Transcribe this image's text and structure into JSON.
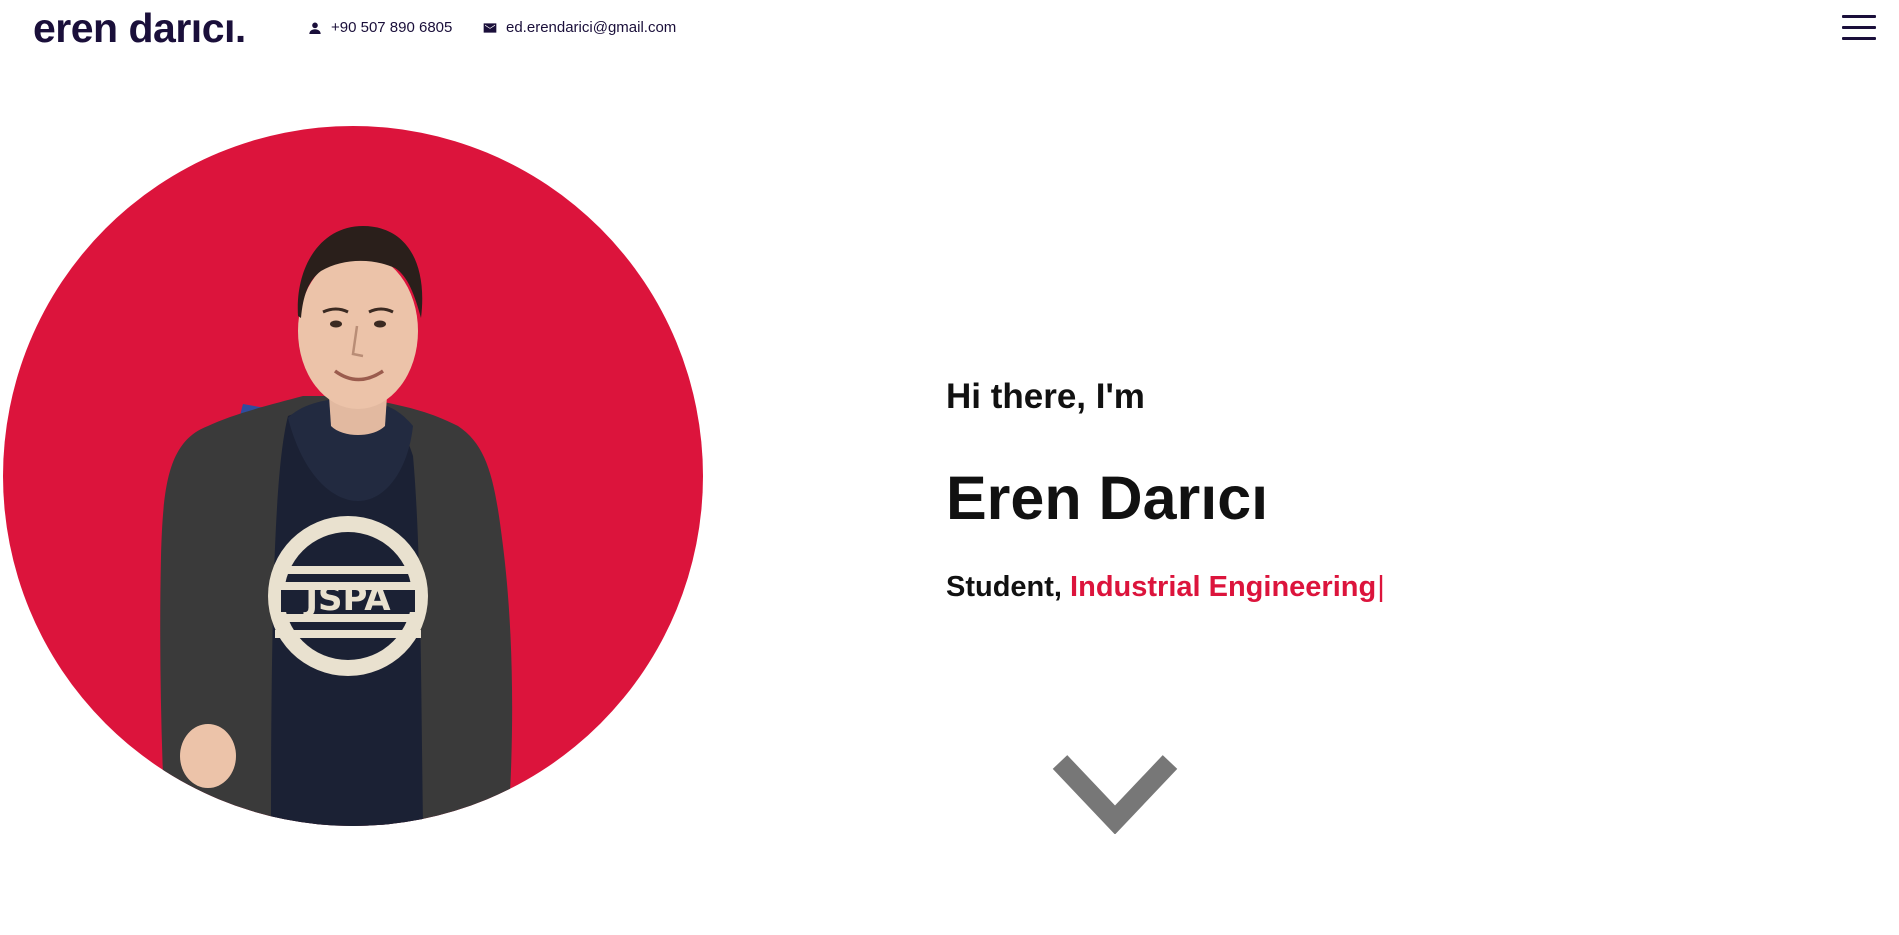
{
  "header": {
    "logo": "eren darıcı.",
    "phone": {
      "icon": "person-icon",
      "text": "+90 507 890 6805"
    },
    "email": {
      "icon": "mail-icon",
      "text": "ed.erendarici@gmail.com"
    },
    "menu_icon": "hamburger-menu-icon"
  },
  "hero": {
    "portrait_alt": "Portrait photo on red circle",
    "greeting": "Hi there, I'm",
    "name": "Eren Darıcı",
    "role_prefix": "Student, ",
    "role_highlight": "Industrial Engineering",
    "cursor": "|",
    "scroll_icon": "chevron-down-icon"
  },
  "colors": {
    "brand_dark": "#1a0f3a",
    "accent_red": "#dc143c",
    "text": "#111111",
    "chevron": "#777777"
  }
}
